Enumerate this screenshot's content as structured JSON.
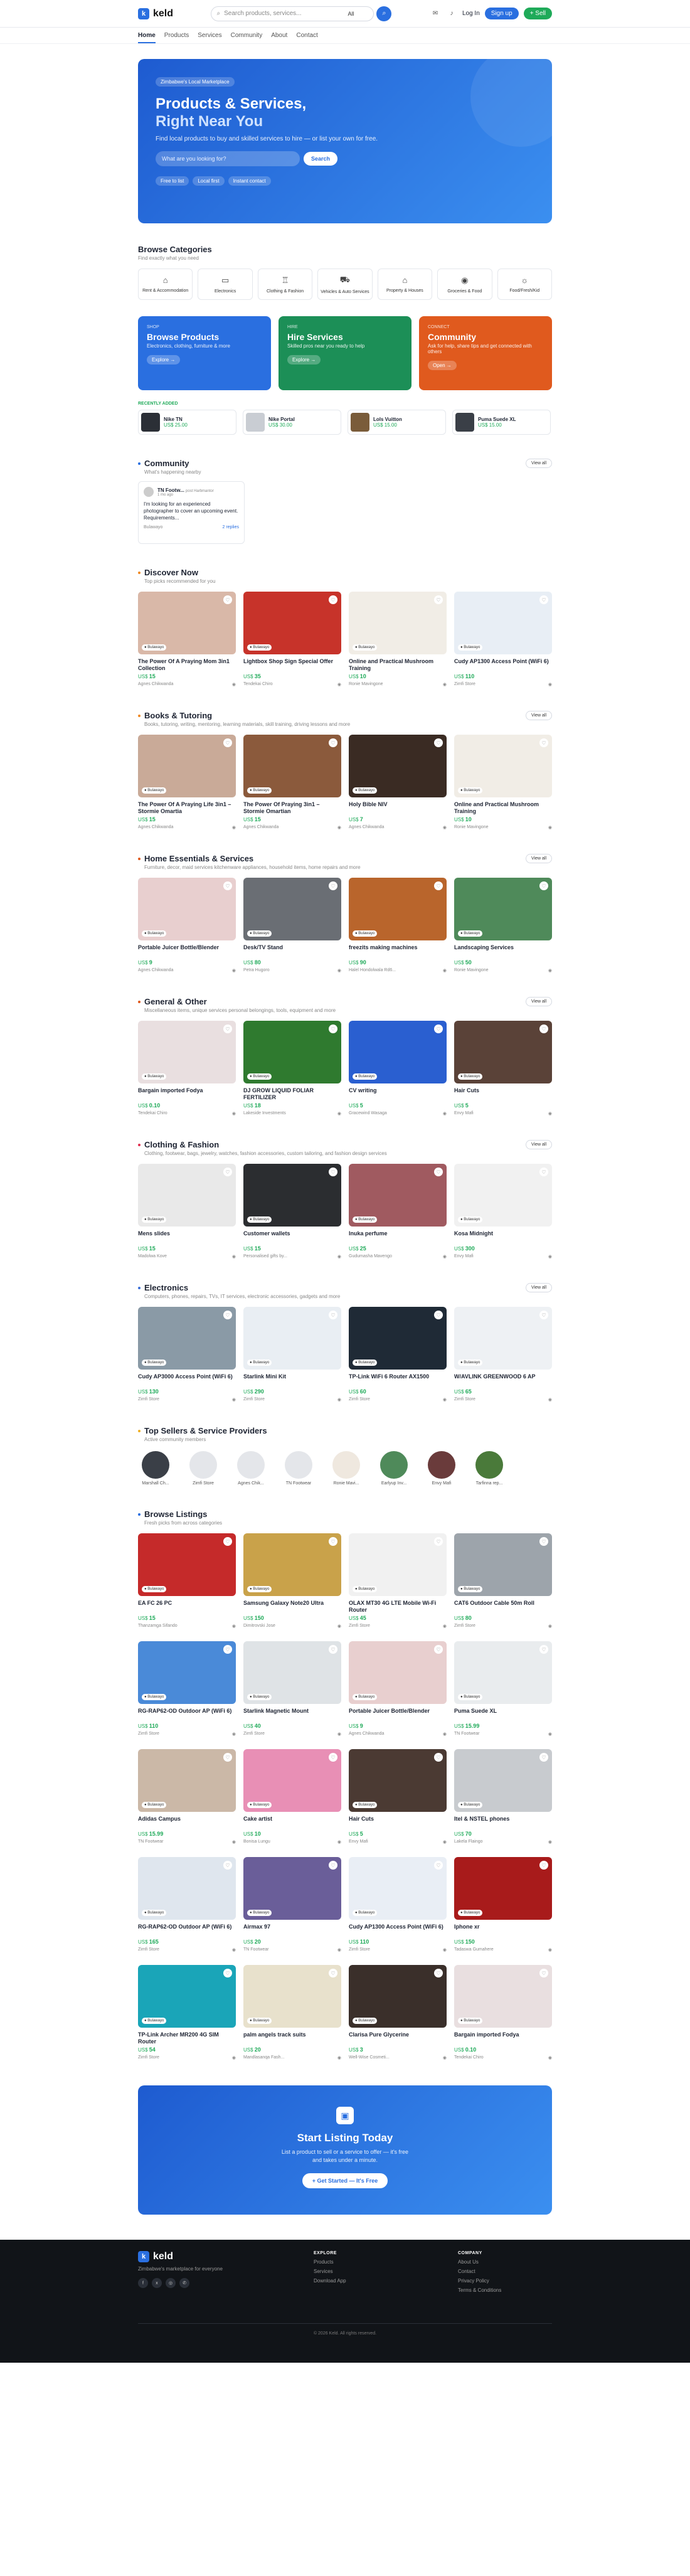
{
  "brand": {
    "name": "keld"
  },
  "topbar": {
    "search_placeholder": "Search products, services...",
    "search_scope": "All",
    "login": "Log In",
    "signup": "Sign up",
    "sell": "+ Sell"
  },
  "nav": [
    "Home",
    "Products",
    "Services",
    "Community",
    "About",
    "Contact"
  ],
  "hero": {
    "badge": "Zimbabwe's Local Marketplace",
    "title1": "Products & Services,",
    "title2": "Right Near You",
    "text": "Find local products to buy and skilled services to hire — or list your own for free.",
    "placeholder": "What are you looking for?",
    "button": "Search",
    "chips": [
      "Free to list",
      "Local first",
      "Instant contact"
    ]
  },
  "categories": {
    "title": "Browse Categories",
    "sub": "Find exactly what you need",
    "items": [
      "Rent & Accommodation",
      "Electronics",
      "Clothing & Fashion",
      "Vehicles & Auto Services",
      "Property & Houses",
      "Groceries & Food",
      "Food/Fresh/Kid"
    ]
  },
  "tiles": [
    {
      "k": "SHOP",
      "title": "Browse Products",
      "sub": "Electronics, clothing, furniture & more",
      "go": "Explore →",
      "color": "#2a6fe0"
    },
    {
      "k": "HIRE",
      "title": "Hire Services",
      "sub": "Skilled pros near you ready to help",
      "go": "Explore →",
      "color": "#1c8f57"
    },
    {
      "k": "CONNECT",
      "title": "Community",
      "sub": "Ask for help, share tips and get connected with others",
      "go": "Open →",
      "color": "#e05a1e"
    }
  ],
  "recent": {
    "label": "RECENTLY ADDED",
    "items": [
      {
        "name": "Nike TN",
        "price": "US$ 25.00"
      },
      {
        "name": "Nike Portal",
        "price": "US$ 30.00"
      },
      {
        "name": "Lols Vuitton",
        "price": "US$ 15.00"
      },
      {
        "name": "Puma Suede XL",
        "price": "US$ 15.00"
      }
    ]
  },
  "community": {
    "title": "Community",
    "sub": "What's happening nearby",
    "view": "View all",
    "post": {
      "author": "TN Footw...",
      "role": "post Harbmantor",
      "time": "1 mo ago",
      "text": "I'm looking for an experienced photographer to cover an upcoming event. Requirements...",
      "loc": "Bulawayo",
      "replies": "2 replies"
    }
  },
  "sections": [
    {
      "title": "Discover Now",
      "sub": "Top picks recommended for you",
      "color": "#f08a24",
      "items": [
        {
          "t": "The Power Of A Praying Mom 3in1 Collection",
          "p": "15",
          "s": "Agnes Chikwanda",
          "c": "#d9b8a8"
        },
        {
          "t": "Lightbox Shop Sign Special Offer",
          "p": "35",
          "s": "Tendekai Chiro",
          "c": "#c7332a"
        },
        {
          "t": "Online and Practical Mushroom Training",
          "p": "10",
          "s": "Ronie Mavingone",
          "c": "#f1ede6"
        },
        {
          "t": "Cudy AP1300 Access Point (WiFi 6)",
          "p": "110",
          "s": "Zimfi Store",
          "c": "#e8eef5"
        }
      ]
    },
    {
      "title": "Books & Tutoring",
      "sub": "Books, tutoring, writing, mentoring, learning materials, skill training, driving lessons and more",
      "color": "#f08a24",
      "items": [
        {
          "t": "The Power Of A Praying Life 3in1 – Stormie Omartia",
          "p": "15",
          "s": "Agnes Chikwanda",
          "c": "#c9aa98"
        },
        {
          "t": "The Power Of Praying 3in1 – Stormie Omartian",
          "p": "15",
          "s": "Agnes Chikwanda",
          "c": "#8b5a3c"
        },
        {
          "t": "Holy Bible NIV",
          "p": "7",
          "s": "Agnes Chikwanda",
          "c": "#3a2b23"
        },
        {
          "t": "Online and Practical Mushroom Training",
          "p": "10",
          "s": "Ronie Mavingone",
          "c": "#f1ede6"
        }
      ]
    },
    {
      "title": "Home Essentials & Services",
      "sub": "Furniture, decor, maid services kitchenware appliances, household items, home repairs and more",
      "color": "#e05a1e",
      "items": [
        {
          "t": "Portable Juicer Bottle/Blender",
          "p": "9",
          "s": "Agnes Chikwanda",
          "c": "#e8cfcf"
        },
        {
          "t": "Desk/TV Stand",
          "p": "80",
          "s": "Petra Hugoro",
          "c": "#6a6e74"
        },
        {
          "t": "freezits making machines",
          "p": "90",
          "s": "Halel Hondolwala Rd6...",
          "c": "#b9652c"
        },
        {
          "t": "Landscaping Services",
          "p": "50",
          "s": "Ronie Mavingone",
          "c": "#4f8a5a"
        }
      ]
    },
    {
      "title": "General & Other",
      "sub": "Miscellaneous items, unique services personal belongings, tools, equipment and more",
      "color": "#e05a1e",
      "items": [
        {
          "t": "Bargain imported Fodya",
          "p": "0.10",
          "s": "Tendekai Chiro",
          "c": "#e9dfe0"
        },
        {
          "t": "DJ GROW LIQUID FOLIAR FERTILIZER",
          "p": "18",
          "s": "Lakeside Investments",
          "c": "#2f7a2f"
        },
        {
          "t": "CV writing",
          "p": "5",
          "s": "Gracewind Wasaga",
          "c": "#2a5fd0"
        },
        {
          "t": "Hair Cuts",
          "p": "5",
          "s": "Envy Mafi",
          "c": "#5a4238"
        }
      ]
    },
    {
      "title": "Clothing & Fashion",
      "sub": "Clothing, footwear, bags, jewelry, watches, fashion accessories, custom tailoring, and fashion design services",
      "color": "#e03050",
      "items": [
        {
          "t": "Mens slides",
          "p": "15",
          "s": "Madolwa Kove",
          "c": "#e9e9e9"
        },
        {
          "t": "Customer wallets",
          "p": "15",
          "s": "Personalised gifts by...",
          "c": "#2b2d30"
        },
        {
          "t": "Inuka perfume",
          "p": "25",
          "s": "Gudumasha Mavengo",
          "c": "#a05a60"
        },
        {
          "t": "Kosa Midnight",
          "p": "300",
          "s": "Envy Mafi",
          "c": "#f1f1f1"
        }
      ]
    },
    {
      "title": "Electronics",
      "sub": "Computers, phones, repairs, TVs, IT services, electronic accessories, gadgets and more",
      "color": "#3a6fd8",
      "items": [
        {
          "t": "Cudy AP3000 Access Point (WiFi 6)",
          "p": "130",
          "s": "Zimfi Store",
          "c": "#8a9aa6"
        },
        {
          "t": "Starlink Mini Kit",
          "p": "290",
          "s": "Zimfi Store",
          "c": "#e9eef3"
        },
        {
          "t": "TP-Link WiFi 6 Router AX1500",
          "p": "60",
          "s": "Zimfi Store",
          "c": "#1f2a36"
        },
        {
          "t": "W/AVLINK GREENWOOD 6 AP",
          "p": "65",
          "s": "Zimfi Store",
          "c": "#eef1f4"
        }
      ]
    }
  ],
  "sellers": {
    "title": "Top Sellers & Service Providers",
    "sub": "Active community members",
    "items": [
      "Marshall Ch...",
      "Zimfi Store",
      "Agnes Chik...",
      "TN Footwear",
      "Ronie Mavi...",
      "Earlyup Inv...",
      "Envy Mafi",
      "Tarfinna rep..."
    ]
  },
  "browse": {
    "title": "Browse Listings",
    "sub": "Fresh picks from across categories",
    "items": [
      {
        "t": "EA FC 26 PC",
        "p": "15",
        "s": "Thanzamga Sifando",
        "c": "#c52a2a"
      },
      {
        "t": "Samsung Galaxy Note20 Ultra",
        "p": "150",
        "s": "Dimitrovski Jose",
        "c": "#c9a24a"
      },
      {
        "t": "OLAX MT30 4G LTE Mobile Wi-Fi Router",
        "p": "45",
        "s": "Zimfi Store",
        "c": "#f1f1f1"
      },
      {
        "t": "CAT6 Outdoor Cable 50m Roll",
        "p": "80",
        "s": "Zimfi Store",
        "c": "#9da4ab"
      },
      {
        "t": "RG-RAP62-OD Outdoor AP (WiFi 6)",
        "p": "110",
        "s": "Zimfi Store",
        "c": "#4a8ad8"
      },
      {
        "t": "Starlink Magnetic Mount",
        "p": "40",
        "s": "Zimfi Store",
        "c": "#dfe3e6"
      },
      {
        "t": "Portable Juicer Bottle/Blender",
        "p": "9",
        "s": "Agnes Chikwanda",
        "c": "#e8cfcf"
      },
      {
        "t": "Puma Suede XL",
        "p": "15.99",
        "s": "TN Footwear",
        "c": "#e9ecee"
      },
      {
        "t": "Adidas Campus",
        "p": "15.99",
        "s": "TN Footwear",
        "c": "#cbb8a7"
      },
      {
        "t": "Cake artist",
        "p": "10",
        "s": "Bonisa Lungu",
        "c": "#e88fb5"
      },
      {
        "t": "Hair Cuts",
        "p": "5",
        "s": "Envy Mafi",
        "c": "#4b3a33"
      },
      {
        "t": "Itel & NSTEL phones",
        "p": "70",
        "s": "Lakela Flaingo",
        "c": "#c8cbcf"
      },
      {
        "t": "RG-RAP62-OD Outdoor AP (WiFi 6)",
        "p": "165",
        "s": "Zimfi Store",
        "c": "#dfe6ee"
      },
      {
        "t": "Airmax 97",
        "p": "20",
        "s": "TN Footwear",
        "c": "#6a5e99"
      },
      {
        "t": "Cudy AP1300 Access Point (WiFi 6)",
        "p": "110",
        "s": "Zimfi Store",
        "c": "#e9eef5"
      },
      {
        "t": "Iphone xr",
        "p": "150",
        "s": "Tadaswa Gumahere",
        "c": "#a81b1b"
      },
      {
        "t": "TP-Link Archer MR200 4G SIM Router",
        "p": "54",
        "s": "Zimfi Store",
        "c": "#1aa5b8"
      },
      {
        "t": "palm angels track suits",
        "p": "20",
        "s": "Mandlasanqa Fash...",
        "c": "#e8e1cc"
      },
      {
        "t": "Clarisa Pure Glycerine",
        "p": "3",
        "s": "Well-Wise Cosmeti...",
        "c": "#3a2f2a"
      },
      {
        "t": "Bargain imported Fodya",
        "p": "0.10",
        "s": "Tendekai Chiro",
        "c": "#e9dfe0"
      }
    ]
  },
  "cta": {
    "title": "Start Listing Today",
    "text1": "List a product to sell or a service to offer — it's free",
    "text2": "and takes under a minute.",
    "button": "+ Get Started — It's Free"
  },
  "footer": {
    "tag": "Zimbabwe's marketplace for everyone",
    "explore": {
      "h": "EXPLORE",
      "links": [
        "Products",
        "Services",
        "Download App"
      ]
    },
    "company": {
      "h": "COMPANY",
      "links": [
        "About Us",
        "Contact",
        "Privacy Policy",
        "Terms & Conditions"
      ]
    },
    "copy": "© 2026 Keld. All rights reserved."
  }
}
